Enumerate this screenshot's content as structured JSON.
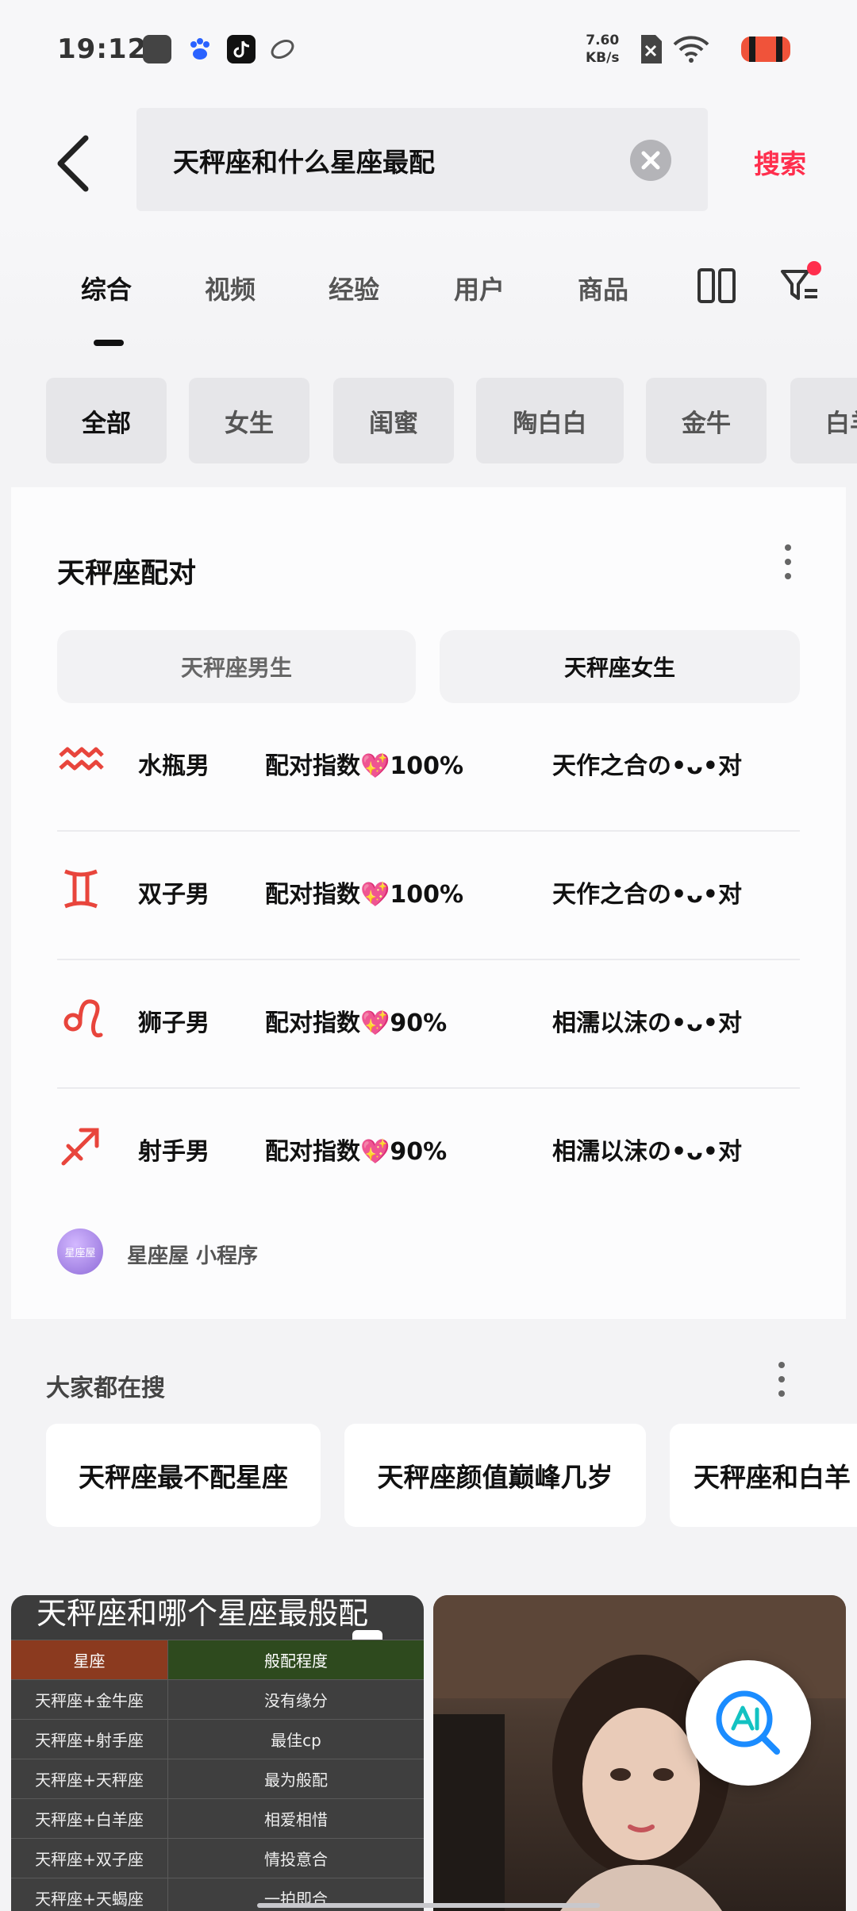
{
  "status_bar": {
    "time": "19:12",
    "net_speed_value": "7.60",
    "net_speed_unit": "KB/s"
  },
  "search": {
    "query": "天秤座和什么星座最配",
    "submit_label": "搜索"
  },
  "tabs": [
    {
      "label": "综合",
      "active": true
    },
    {
      "label": "视频",
      "active": false
    },
    {
      "label": "经验",
      "active": false
    },
    {
      "label": "用户",
      "active": false
    },
    {
      "label": "商品",
      "active": false
    }
  ],
  "chips": [
    {
      "label": "全部",
      "active": true
    },
    {
      "label": "女生",
      "active": false
    },
    {
      "label": "闺蜜",
      "active": false
    },
    {
      "label": "陶白白",
      "active": false
    },
    {
      "label": "金牛",
      "active": false
    },
    {
      "label": "白羊",
      "active": false
    }
  ],
  "pairing_card": {
    "title": "天秤座配对",
    "segments": [
      {
        "label": "天秤座男生",
        "active": false
      },
      {
        "label": "天秤座女生",
        "active": true
      }
    ],
    "rows": [
      {
        "icon": "aquarius-icon",
        "sign": "水瓶男",
        "index": "配对指数💖100%",
        "desc": "天作之合の•ᴗ•对"
      },
      {
        "icon": "gemini-icon",
        "sign": "双子男",
        "index": "配对指数💖100%",
        "desc": "天作之合の•ᴗ•对"
      },
      {
        "icon": "leo-icon",
        "sign": "狮子男",
        "index": "配对指数💖90%",
        "desc": "相濡以沫の•ᴗ•对"
      },
      {
        "icon": "sagittarius-icon",
        "sign": "射手男",
        "index": "配对指数💖90%",
        "desc": "相濡以沫の•ᴗ•对"
      }
    ],
    "source_avatar_text": "星座屋",
    "source_name": "星座屋  小程序",
    "accent_color": "#e8453c"
  },
  "trending": {
    "title": "大家都在搜",
    "items": [
      "天秤座最不配星座",
      "天秤座颜值巅峰几岁",
      "天秤座和白羊"
    ]
  },
  "feed": {
    "left_post": {
      "title": "天秤座和哪个星座最般配",
      "table_header": [
        "星座",
        "般配程度"
      ],
      "table_rows": [
        [
          "天秤座+金牛座",
          "没有缘分"
        ],
        [
          "天秤座+射手座",
          "最佳cp"
        ],
        [
          "天秤座+天秤座",
          "最为般配"
        ],
        [
          "天秤座+白羊座",
          "相爱相惜"
        ],
        [
          "天秤座+双子座",
          "情投意合"
        ],
        [
          "天秤座+天蝎座",
          "一拍即合"
        ]
      ]
    }
  },
  "colors": {
    "brand_red": "#ff2e4d",
    "background": "#f3f3f5"
  }
}
